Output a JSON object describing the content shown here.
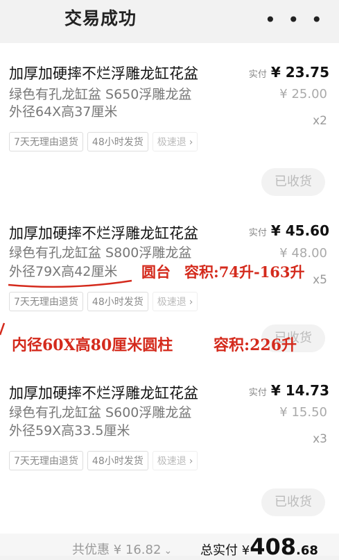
{
  "header": {
    "title": "交易成功",
    "more_icon": "more-dots-icon",
    "more_glyph": "• • •"
  },
  "items": [
    {
      "name": "加厚加硬摔不烂浮雕龙缸花盆",
      "sku_line1": "绿色有孔龙缸盆 S650浮雕龙盆",
      "sku_line2": "外径64X高37厘米",
      "paid_label": "实付",
      "paid": "¥ 23.75",
      "original": "¥ 25.00",
      "qty": "x2",
      "tags": [
        "7天无理由退货",
        "48小时发货",
        "极速退"
      ],
      "status": "已收货"
    },
    {
      "name": "加厚加硬摔不烂浮雕龙缸花盆",
      "sku_line1": "绿色有孔龙缸盆 S800浮雕龙盆",
      "sku_line2": "外径79X高42厘米",
      "paid_label": "实付",
      "paid": "¥ 45.60",
      "original": "¥ 48.00",
      "qty": "x5",
      "tags": [
        "7天无理由退货",
        "48小时发货",
        "极速退"
      ],
      "status": "已收货"
    },
    {
      "name": "加厚加硬摔不烂浮雕龙缸花盆",
      "sku_line1": "绿色有孔龙缸盆 S600浮雕龙盆",
      "sku_line2": "外径59X高33.5厘米",
      "paid_label": "实付",
      "paid": "¥ 14.73",
      "original": "¥ 15.50",
      "qty": "x3",
      "tags": [
        "7天无理由退货",
        "48小时发货",
        "极速退"
      ],
      "status": "已收货"
    }
  ],
  "annotations": {
    "shape": "圆台",
    "volume_range": "容积:74升-163升",
    "inner": "内径60X高80厘米圆柱",
    "volume2": "容积:226升"
  },
  "footer": {
    "discount": "共优惠 ¥ 16.82",
    "total_label": "总实付 ¥",
    "total_int": "408",
    "total_dec": ".68"
  },
  "colors": {
    "annotation": "#d42a1c",
    "background": "#f2f2f2"
  }
}
